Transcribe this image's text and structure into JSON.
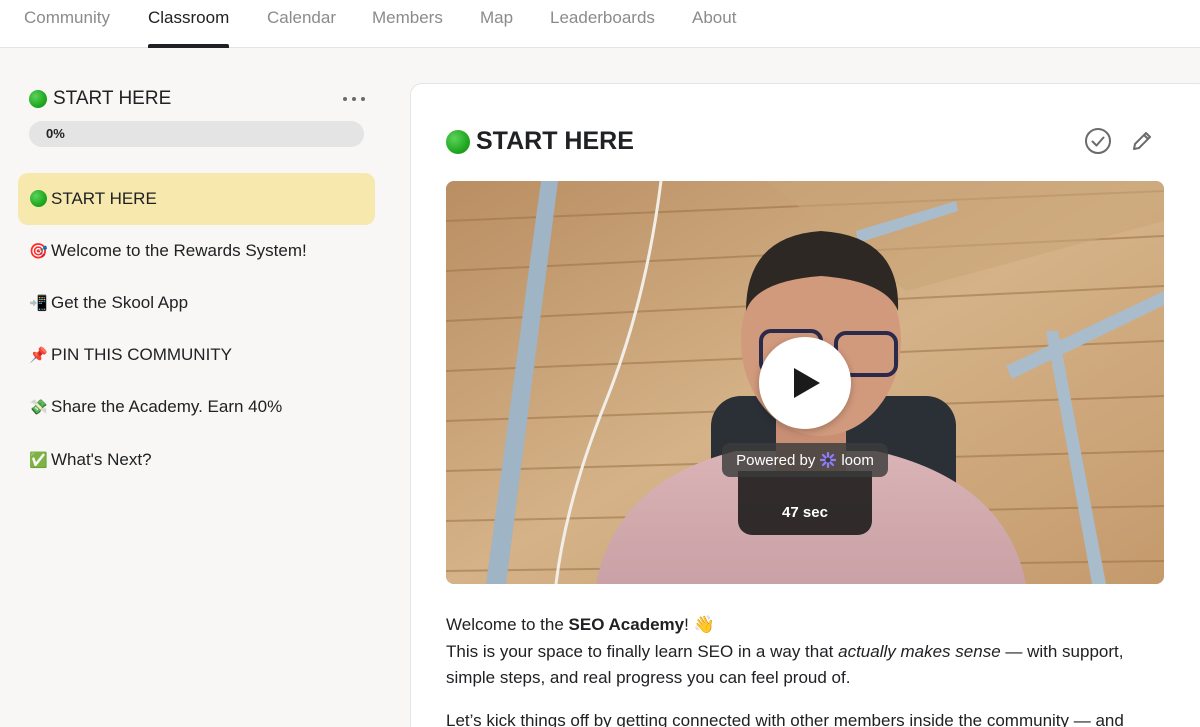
{
  "nav": {
    "tabs": [
      {
        "label": "Community"
      },
      {
        "label": "Classroom",
        "active": true
      },
      {
        "label": "Calendar"
      },
      {
        "label": "Members"
      },
      {
        "label": "Map"
      },
      {
        "label": "Leaderboards"
      },
      {
        "label": "About"
      }
    ]
  },
  "sidebar": {
    "module_title": "START HERE",
    "progress_label": "0%",
    "progress_value": 0,
    "lessons": [
      {
        "icon": "green-circle",
        "emoji": "",
        "label": "START HERE",
        "active": true
      },
      {
        "icon": "target-icon",
        "emoji": "🎯",
        "label": "Welcome to the Rewards System!"
      },
      {
        "icon": "phone-icon",
        "emoji": "📲",
        "label": "Get the Skool App"
      },
      {
        "icon": "pushpin-icon",
        "emoji": "📌",
        "label": "PIN THIS COMMUNITY"
      },
      {
        "icon": "money-icon",
        "emoji": "💸",
        "label": "Share the Academy. Earn 40%"
      },
      {
        "icon": "check-mark-icon",
        "emoji": "✅",
        "label": "What's Next?"
      }
    ]
  },
  "main": {
    "title": "START HERE",
    "video": {
      "powered_by": "Powered by",
      "brand": "loom",
      "duration": "47 sec"
    },
    "body": {
      "welcome_prefix": "Welcome to the ",
      "welcome_bold": "SEO Academy",
      "welcome_suffix": "! 👋",
      "line2_prefix": "This is your space to finally learn SEO in a way that ",
      "line2_italic": "actually makes sense",
      "line2_suffix": " — with support, simple steps, and real progress you can feel proud of.",
      "para2": "Let’s kick things off by getting connected with other members inside the community — and"
    }
  },
  "colors": {
    "accent_active_lesson": "#f7e8ad",
    "nav_active": "#202124",
    "nav_inactive": "#8b8b8b",
    "status_green": "#21a821"
  }
}
